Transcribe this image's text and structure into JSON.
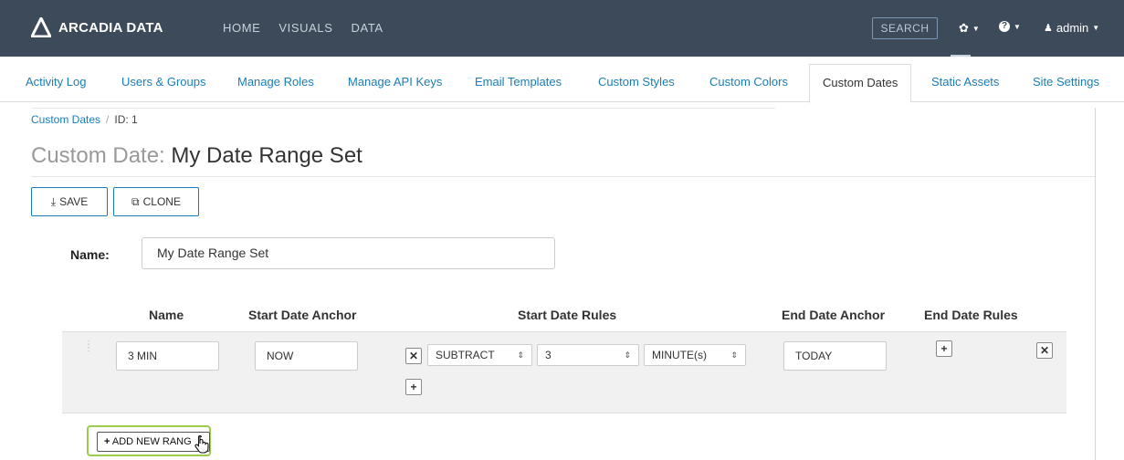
{
  "app": {
    "brand": "ARCADIA DATA",
    "nav": [
      "HOME",
      "VISUALS",
      "DATA"
    ],
    "search_label": "SEARCH",
    "user_label": "admin",
    "colors": {
      "navbar": "#3c4a59",
      "accent": "#1a7db7",
      "highlight": "#9ccc4c"
    }
  },
  "tabs": [
    "Activity Log",
    "Users & Groups",
    "Manage Roles",
    "Manage API Keys",
    "Email Templates",
    "Custom Styles",
    "Custom Colors",
    "Custom Dates",
    "Static Assets",
    "Site Settings"
  ],
  "active_tab": "Custom Dates",
  "breadcrumb": {
    "parent": "Custom Dates",
    "separator": "/",
    "current": "ID: 1"
  },
  "page": {
    "title_prefix": "Custom Date:",
    "title_name": "My Date Range Set",
    "save_label": "SAVE",
    "clone_label": "CLONE"
  },
  "form": {
    "name_label": "Name:",
    "name_value": "My Date Range Set"
  },
  "table": {
    "headers": [
      "Name",
      "Start Date Anchor",
      "Start Date Rules",
      "End Date Anchor",
      "End Date Rules"
    ],
    "rows": [
      {
        "name": "3 MIN",
        "start_anchor": "NOW",
        "start_rule": {
          "operation": "SUBTRACT",
          "amount": "3",
          "unit": "MINUTE(s)"
        },
        "end_anchor": "TODAY"
      }
    ],
    "add_label": "ADD NEW RANG"
  },
  "icons": [
    "download-icon",
    "clone-icon",
    "gear-icon",
    "help-icon",
    "user-icon",
    "remove-icon",
    "add-icon",
    "drag-handle-icon",
    "hand-cursor-icon"
  ]
}
